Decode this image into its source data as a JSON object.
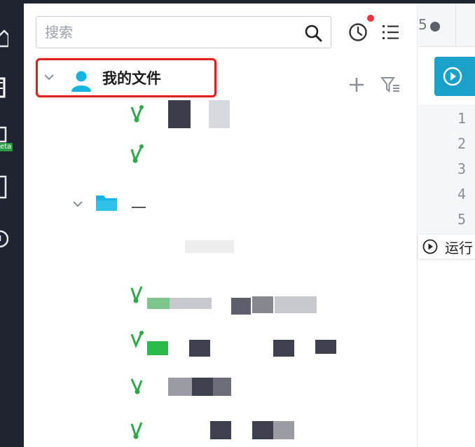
{
  "search": {
    "placeholder": "搜索",
    "icon": "search-icon"
  },
  "toolbar": {
    "history_icon": "clock-icon",
    "notification": true,
    "list_icon": "list-icon",
    "add_icon": "plus-icon",
    "filter_icon": "filter-icon"
  },
  "tree": {
    "root_label": "我的文件",
    "root_icon": "user-icon",
    "folder_icon": "folder-icon",
    "node_icon": "node-branch-icon"
  },
  "left_rail": {
    "badge": "eta"
  },
  "editor": {
    "tab_partial": "5",
    "line_numbers": [
      "1",
      "2",
      "3",
      "4",
      "5"
    ],
    "run_label": "运行"
  },
  "colors": {
    "rail": "#1f2430",
    "accent": "#1aa1c9",
    "node_green": "#2ea84a",
    "highlight_red": "#e01e1e",
    "notify_red": "#f0303a"
  }
}
